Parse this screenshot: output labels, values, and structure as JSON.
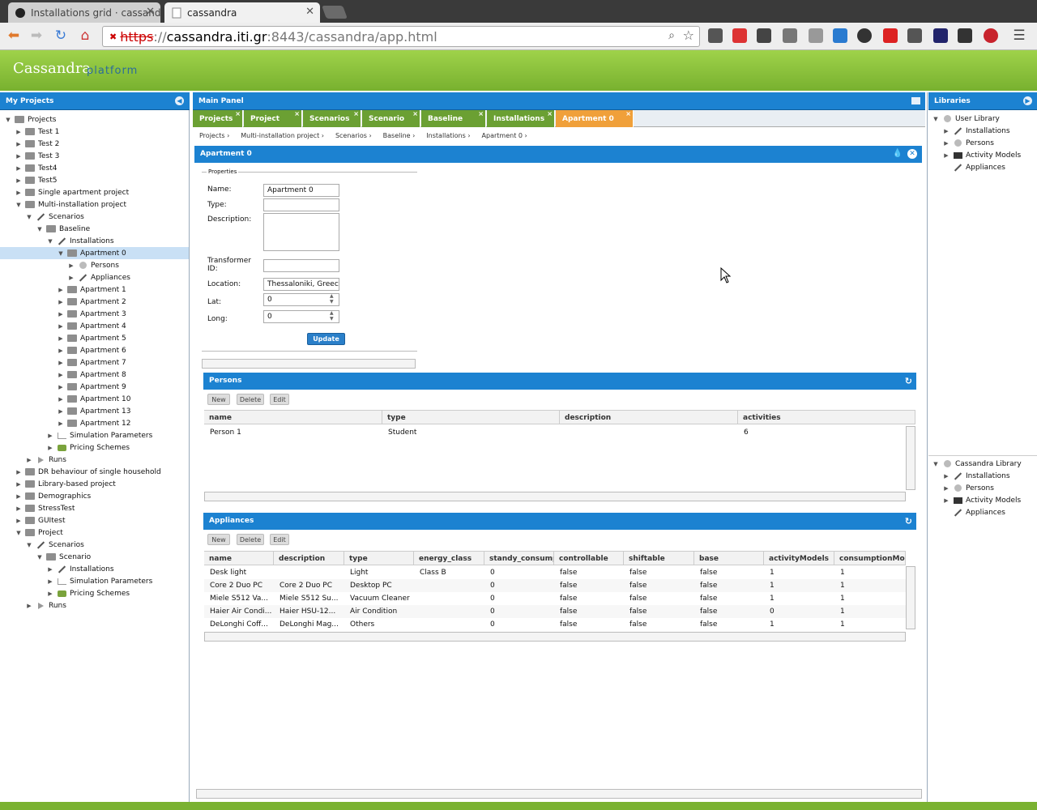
{
  "browser": {
    "tabs": [
      {
        "title": "Installations grid · cassand"
      },
      {
        "title": "cassandra"
      }
    ],
    "url": {
      "scheme": "https",
      "host": "cassandra.iti.gr",
      "rest": ":8443/cassandra/app.html"
    }
  },
  "app": {
    "logo": "Cassandra",
    "subtitle": "platform"
  },
  "left_panel": {
    "title": "My Projects",
    "tree": [
      {
        "label": "Projects",
        "depth": 0,
        "icon": "tree",
        "arrow": "▼"
      },
      {
        "label": "Test 1",
        "depth": 1,
        "icon": "folder",
        "arrow": "▶"
      },
      {
        "label": "Test 2",
        "depth": 1,
        "icon": "folder",
        "arrow": "▶"
      },
      {
        "label": "Test 3",
        "depth": 1,
        "icon": "folder",
        "arrow": "▶"
      },
      {
        "label": "Test4",
        "depth": 1,
        "icon": "folder",
        "arrow": "▶"
      },
      {
        "label": "Test5",
        "depth": 1,
        "icon": "folder",
        "arrow": "▶"
      },
      {
        "label": "Single apartment project",
        "depth": 1,
        "icon": "folder",
        "arrow": "▶"
      },
      {
        "label": "Multi-installation project",
        "depth": 1,
        "icon": "folder",
        "arrow": "▼"
      },
      {
        "label": "Scenarios",
        "depth": 2,
        "icon": "wand",
        "arrow": "▼"
      },
      {
        "label": "Baseline",
        "depth": 3,
        "icon": "folder",
        "arrow": "▼"
      },
      {
        "label": "Installations",
        "depth": 4,
        "icon": "wand",
        "arrow": "▼"
      },
      {
        "label": "Apartment 0",
        "depth": 5,
        "icon": "folder",
        "arrow": "▼",
        "selected": true
      },
      {
        "label": "Persons",
        "depth": 6,
        "icon": "person",
        "arrow": "▶"
      },
      {
        "label": "Appliances",
        "depth": 6,
        "icon": "wand",
        "arrow": "▶"
      },
      {
        "label": "Apartment 1",
        "depth": 5,
        "icon": "folder",
        "arrow": "▶"
      },
      {
        "label": "Apartment 2",
        "depth": 5,
        "icon": "folder",
        "arrow": "▶"
      },
      {
        "label": "Apartment 3",
        "depth": 5,
        "icon": "folder",
        "arrow": "▶"
      },
      {
        "label": "Apartment 4",
        "depth": 5,
        "icon": "folder",
        "arrow": "▶"
      },
      {
        "label": "Apartment 5",
        "depth": 5,
        "icon": "folder",
        "arrow": "▶"
      },
      {
        "label": "Apartment 6",
        "depth": 5,
        "icon": "folder",
        "arrow": "▶"
      },
      {
        "label": "Apartment 7",
        "depth": 5,
        "icon": "folder",
        "arrow": "▶"
      },
      {
        "label": "Apartment 8",
        "depth": 5,
        "icon": "folder",
        "arrow": "▶"
      },
      {
        "label": "Apartment 9",
        "depth": 5,
        "icon": "folder",
        "arrow": "▶"
      },
      {
        "label": "Apartment 10",
        "depth": 5,
        "icon": "folder",
        "arrow": "▶"
      },
      {
        "label": "Apartment 13",
        "depth": 5,
        "icon": "folder",
        "arrow": "▶"
      },
      {
        "label": "Apartment 12",
        "depth": 5,
        "icon": "folder",
        "arrow": "▶"
      },
      {
        "label": "Simulation Parameters",
        "depth": 4,
        "icon": "chart",
        "arrow": "▶"
      },
      {
        "label": "Pricing Schemes",
        "depth": 4,
        "icon": "dollar",
        "arrow": "▶"
      },
      {
        "label": "Runs",
        "depth": 2,
        "icon": "play",
        "arrow": "▶"
      },
      {
        "label": "DR behaviour of single household",
        "depth": 1,
        "icon": "folder",
        "arrow": "▶"
      },
      {
        "label": "Library-based project",
        "depth": 1,
        "icon": "folder",
        "arrow": "▶"
      },
      {
        "label": "Demographics",
        "depth": 1,
        "icon": "folder",
        "arrow": "▶"
      },
      {
        "label": "StressTest",
        "depth": 1,
        "icon": "folder",
        "arrow": "▶"
      },
      {
        "label": "GUItest",
        "depth": 1,
        "icon": "folder",
        "arrow": "▶"
      },
      {
        "label": "Project",
        "depth": 1,
        "icon": "folder",
        "arrow": "▼"
      },
      {
        "label": "Scenarios",
        "depth": 2,
        "icon": "wand",
        "arrow": "▼"
      },
      {
        "label": "Scenario",
        "depth": 3,
        "icon": "folder",
        "arrow": "▼"
      },
      {
        "label": "Installations",
        "depth": 4,
        "icon": "wand",
        "arrow": "▶"
      },
      {
        "label": "Simulation Parameters",
        "depth": 4,
        "icon": "chart",
        "arrow": "▶"
      },
      {
        "label": "Pricing Schemes",
        "depth": 4,
        "icon": "dollar",
        "arrow": "▶"
      },
      {
        "label": "Runs",
        "depth": 2,
        "icon": "play",
        "arrow": "▶"
      }
    ]
  },
  "main_panel": {
    "title": "Main Panel",
    "tabs": [
      {
        "label": "Projects",
        "active": false
      },
      {
        "label": "Project",
        "active": false
      },
      {
        "label": "Scenarios",
        "active": false
      },
      {
        "label": "Scenario",
        "active": false
      },
      {
        "label": "Baseline",
        "active": false
      },
      {
        "label": "Installations",
        "active": false
      },
      {
        "label": "Apartment 0",
        "active": true
      }
    ],
    "breadcrumb": [
      "Projects ›",
      "Multi-installation project ›",
      "Scenarios ›",
      "Baseline ›",
      "Installations ›",
      "Apartment 0 ›"
    ],
    "form": {
      "header": "Apartment 0",
      "legend": "Properties",
      "name_label": "Name:",
      "name_value": "Apartment 0",
      "type_label": "Type:",
      "type_value": "",
      "description_label": "Description:",
      "description_value": "",
      "transformer_label_1": "Transformer",
      "transformer_label_2": "ID:",
      "transformer_value": "",
      "location_label": "Location:",
      "location_value": "Thessaloniki, Greece",
      "lat_label": "Lat:",
      "lat_value": "0",
      "long_label": "Long:",
      "long_value": "0",
      "update_button": "Update"
    },
    "persons": {
      "title": "Persons",
      "buttons": {
        "new": "New",
        "delete": "Delete",
        "edit": "Edit"
      },
      "columns": [
        "name",
        "type",
        "description",
        "activities"
      ],
      "rows": [
        [
          "Person 1",
          "Student",
          "",
          "6"
        ]
      ]
    },
    "appliances": {
      "title": "Appliances",
      "buttons": {
        "new": "New",
        "delete": "Delete",
        "edit": "Edit"
      },
      "columns": [
        "name",
        "description",
        "type",
        "energy_class",
        "standy_consumpt",
        "controllable",
        "shiftable",
        "base",
        "activityModels",
        "consumptionMod"
      ],
      "rows": [
        [
          "Desk light",
          "",
          "Light",
          "Class B",
          "0",
          "false",
          "false",
          "false",
          "1",
          "1"
        ],
        [
          "Core 2 Duo PC",
          "Core 2 Duo PC",
          "Desktop PC",
          "",
          "0",
          "false",
          "false",
          "false",
          "1",
          "1"
        ],
        [
          "Miele S512 Va...",
          "Miele S512 Su...",
          "Vacuum Cleaner",
          "",
          "0",
          "false",
          "false",
          "false",
          "1",
          "1"
        ],
        [
          "Haier Air Condi...",
          "Haier HSU-12...",
          "Air Condition",
          "",
          "0",
          "false",
          "false",
          "false",
          "0",
          "1"
        ],
        [
          "DeLonghi Coff...",
          "DeLonghi Mag...",
          "Others",
          "",
          "0",
          "false",
          "false",
          "false",
          "1",
          "1"
        ]
      ]
    }
  },
  "right_panel": {
    "title": "Libraries",
    "user_library": {
      "label": "User Library",
      "items": [
        "Installations",
        "Persons",
        "Activity Models",
        "Appliances"
      ]
    },
    "cassandra_library": {
      "label": "Cassandra Library",
      "items": [
        "Installations",
        "Persons",
        "Activity Models",
        "Appliances"
      ]
    }
  },
  "colors": {
    "header_blue": "#1c82d1",
    "banner_green": "#8cc43d",
    "tab_green": "#6ba033",
    "tab_active": "#f0a03a"
  }
}
